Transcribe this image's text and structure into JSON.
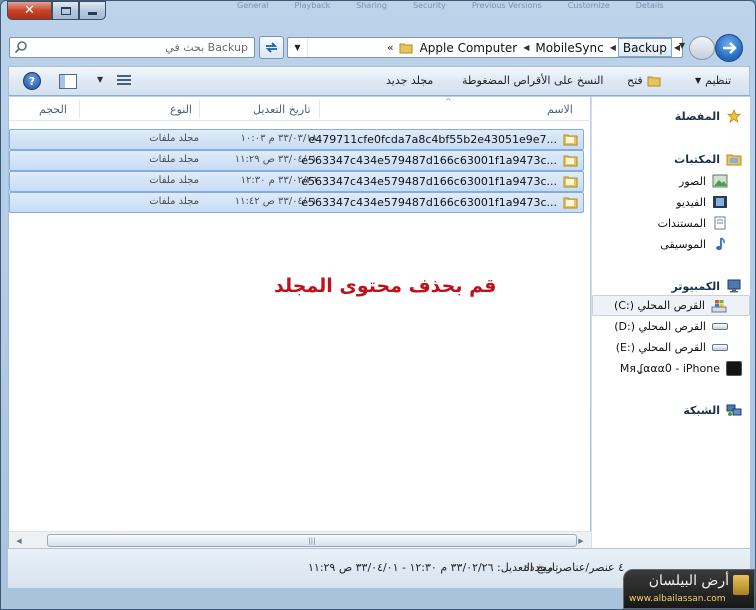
{
  "window": {
    "caption_close": "✕",
    "background_tabs": [
      "General",
      "Playback",
      "Sharing",
      "Security",
      "Previous Versions",
      "Customize",
      "Details"
    ]
  },
  "address_bar": {
    "search_placeholder": "بحث في Backup",
    "crumbs": [
      "Apple Computer",
      "MobileSync",
      "Backup"
    ],
    "more_glyph": "«"
  },
  "toolbar": {
    "organize": "تنظيم",
    "open": "فتح",
    "burn": "النسخ على الأقراص المضغوطة",
    "new_folder": "مجلد جديد",
    "help": "?"
  },
  "columns": {
    "name": "الاسم",
    "date": "تاريخ التعديل",
    "type": "النوع",
    "size": "الحجم"
  },
  "files": [
    {
      "name": "e479711cfe0fcda7a8c4bf55b2e43051e9e7...",
      "date": "٣٣/٠٣/١٨ م ١٠:٠٣",
      "type": "مجلد ملفات"
    },
    {
      "name": "e563347c434e579487d166c63001f1a9473c...",
      "date": "٣٣/٠٤/٠١ ص ١١:٢٩",
      "type": "مجلد ملفات"
    },
    {
      "name": "e563347c434e579487d166c63001f1a9473c...",
      "date": "٣٣/٠٢/٢٦ م ١٢:٣٠",
      "type": "مجلد ملفات"
    },
    {
      "name": "e563347c434e579487d166c63001f1a9473c...",
      "date": "٣٣/٠٤/٠١ ص ١١:٤٢",
      "type": "مجلد ملفات"
    }
  ],
  "overlay_text": "قم بحذف محتوى المجلد",
  "nav_pane": {
    "favorites": "المفضلة",
    "libraries": "المكتبات",
    "pictures": "الصور",
    "videos": "الفيديو",
    "documents": "المستندات",
    "music": "الموسيقى",
    "computer": "الكمبيوتر",
    "drive_c": "القرص المحلي (:C)",
    "drive_d": "القرص المحلي (:D)",
    "drive_e": "القرص المحلي (:E)",
    "iphone": "Mя.ʆααα߀ - iPhone",
    "network": "الشبكة"
  },
  "status_bar": {
    "count": "٤ عنصر/عناصر محددة",
    "detail": "تاريخ التعديل: ٣٣/٠٢/٢٦ م ١٢:٣٠ - ٣٣/٠٤/٠١ ص ١١:٢٩"
  },
  "watermark": {
    "title": "أرض البيلسان",
    "url": "www.albailassan.com"
  },
  "colors": {
    "selection": "#c6dcf5",
    "overlay_text": "#c0101c",
    "accent": "#1f66bf"
  }
}
